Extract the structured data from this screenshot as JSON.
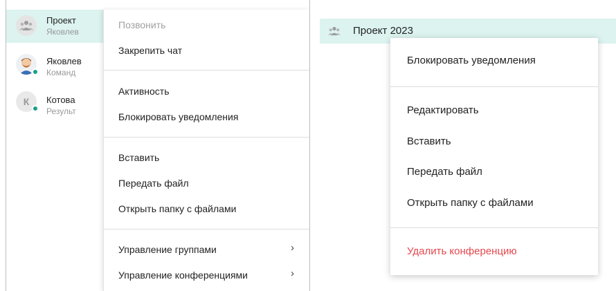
{
  "left": {
    "chats": [
      {
        "name": "Проект",
        "subtitle": "Яковлев",
        "icon": "group-icon",
        "active": true
      },
      {
        "name": "Яковлев",
        "subtitle": "Команд",
        "icon": "avatar-photo",
        "online": true
      },
      {
        "name": "Котова",
        "subtitle": "Результ",
        "avatar_letter": "К",
        "online": true
      }
    ],
    "menu": {
      "call": "Позвонить",
      "pin_chat": "Закрепить чат",
      "activity": "Активность",
      "block_notifications": "Блокировать уведомления",
      "paste": "Вставить",
      "send_file": "Передать файл",
      "open_files_folder": "Открыть папку с файлами",
      "manage_groups": "Управление группами",
      "manage_conferences": "Управление конференциями",
      "chevron": "›"
    }
  },
  "right": {
    "header_title": "Проект 2023",
    "header_icon": "group-icon",
    "menu": {
      "block_notifications": "Блокировать уведомления",
      "edit": "Редактировать",
      "paste": "Вставить",
      "send_file": "Передать файл",
      "open_files_folder": "Открыть папку с файлами",
      "delete_conference": "Удалить конференцию"
    }
  },
  "colors": {
    "active_row": "#dcf3ef",
    "online": "#18a08c",
    "danger": "#e5484d"
  }
}
